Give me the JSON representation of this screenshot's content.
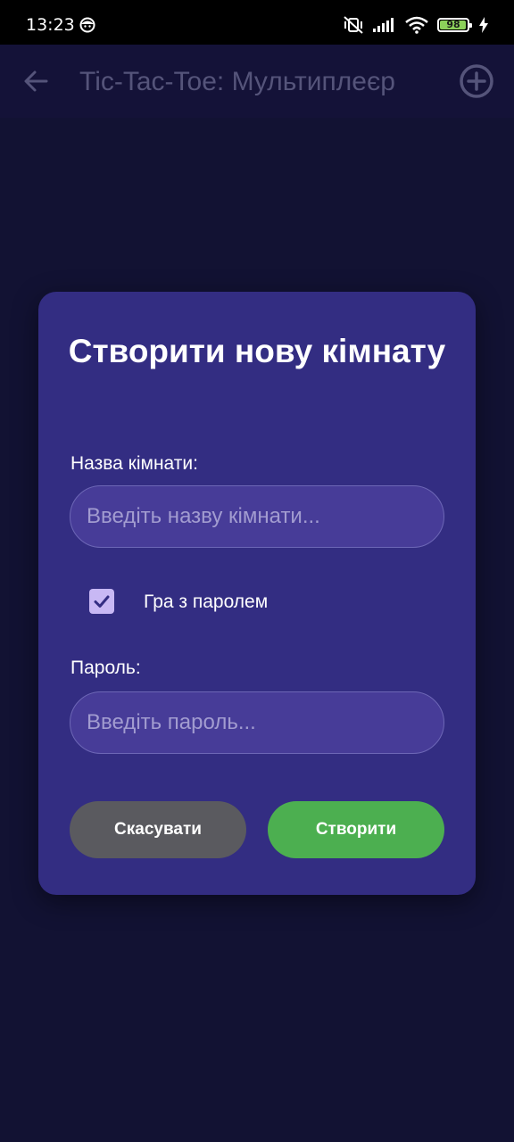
{
  "status_bar": {
    "time": "13:23",
    "battery_level": "98",
    "battery_fraction": 0.98
  },
  "app_bar": {
    "title": "Tic-Tac-Toe: Мультиплеєр",
    "back_icon": "arrow-left-icon",
    "add_icon": "plus-circle-icon"
  },
  "dialog": {
    "title": "Створити нову кімнату",
    "room_name_label": "Назва кімнати:",
    "room_name_value": "",
    "room_name_placeholder": "Введіть назву кімнати...",
    "password_checkbox_label": "Гра з паролем",
    "password_checkbox_checked": true,
    "password_label": "Пароль:",
    "password_value": "",
    "password_placeholder": "Введіть пароль...",
    "cancel_label": "Скасувати",
    "create_label": "Створити"
  },
  "colors": {
    "background": "#121233",
    "app_bar": "#141238",
    "dialog": "#332d82",
    "input_fill": "#473c98",
    "checkbox": "#c8b8f4",
    "cancel_button": "#5a5a5f",
    "create_button": "#4caf50"
  }
}
